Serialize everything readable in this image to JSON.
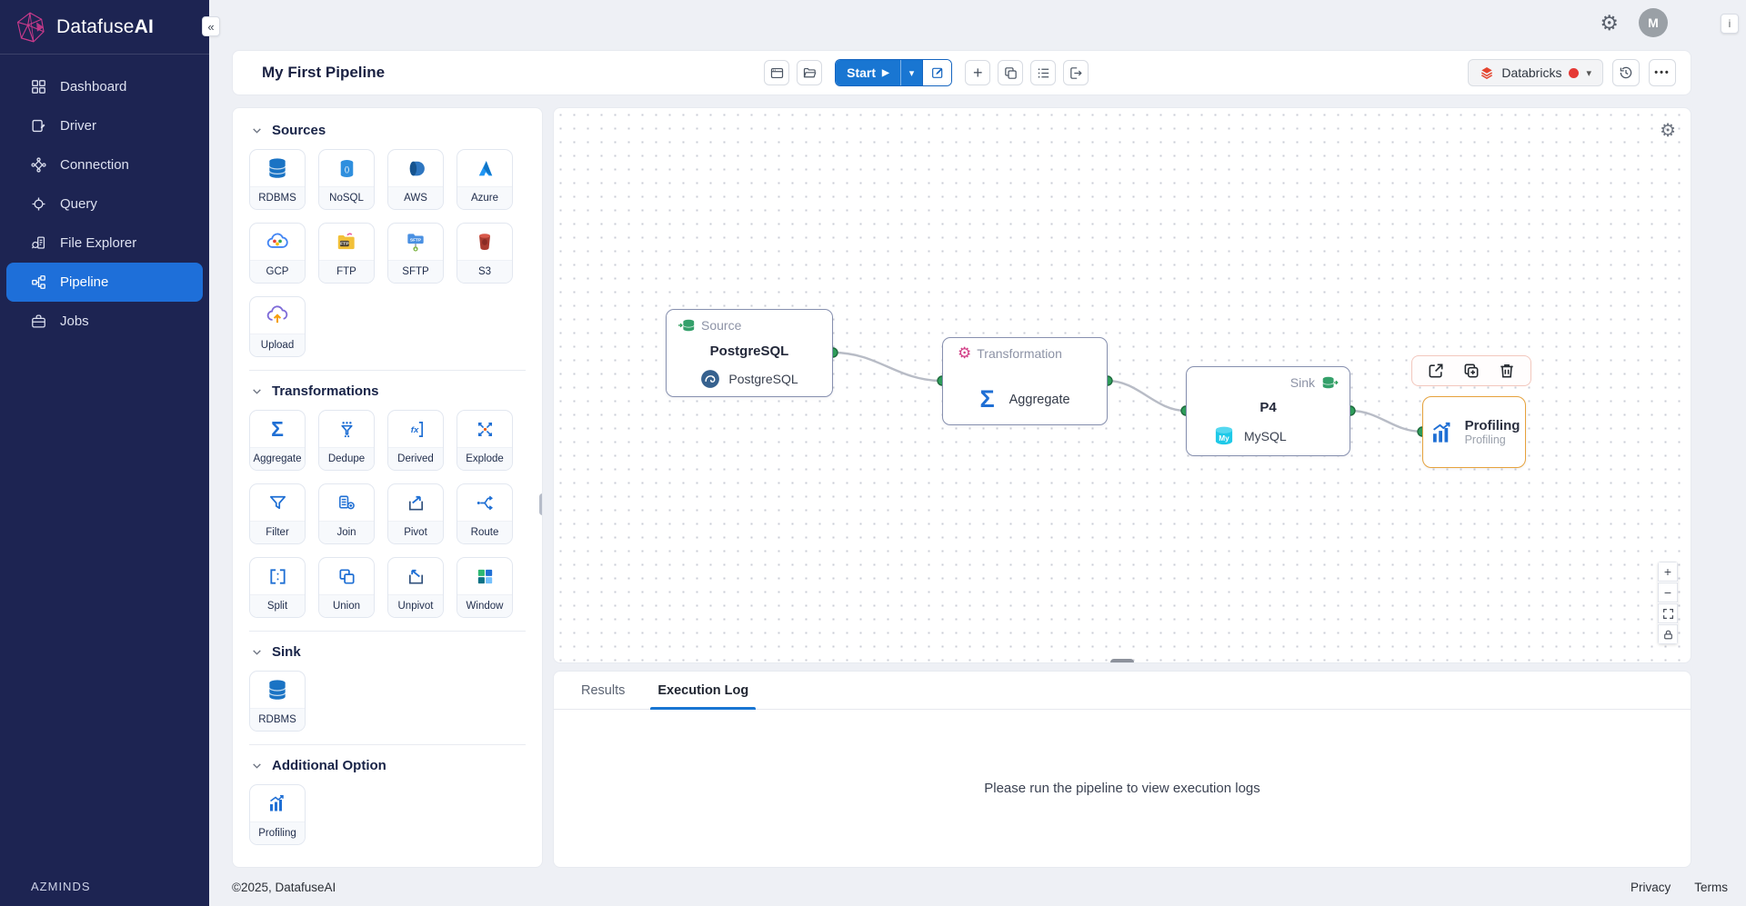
{
  "brand": {
    "name_regular": "Datafuse",
    "name_bold": "AI",
    "org": "AZMINDS"
  },
  "sidebar": {
    "active_item": "Pipeline",
    "items": [
      {
        "label": "Dashboard"
      },
      {
        "label": "Driver"
      },
      {
        "label": "Connection"
      },
      {
        "label": "Query"
      },
      {
        "label": "File Explorer"
      },
      {
        "label": "Pipeline"
      },
      {
        "label": "Jobs"
      }
    ]
  },
  "topbar": {
    "avatar_initial": "M",
    "info_badge": "i"
  },
  "header": {
    "title": "My First Pipeline",
    "start_label": "Start",
    "connection_label": "Databricks"
  },
  "palette": {
    "sections": [
      {
        "title": "Sources",
        "items": [
          "RDBMS",
          "NoSQL",
          "AWS",
          "Azure",
          "GCP",
          "FTP",
          "SFTP",
          "S3",
          "Upload"
        ]
      },
      {
        "title": "Transformations",
        "items": [
          "Aggregate",
          "Dedupe",
          "Derived",
          "Explode",
          "Filter",
          "Join",
          "Pivot",
          "Route",
          "Split",
          "Union",
          "Unpivot",
          "Window"
        ]
      },
      {
        "title": "Sink",
        "items": [
          "RDBMS"
        ]
      },
      {
        "title": "Additional Option",
        "items": [
          "Profiling"
        ]
      }
    ]
  },
  "canvas": {
    "nodes": [
      {
        "type_label": "Source",
        "title": "PostgreSQL",
        "subtitle": "PostgreSQL"
      },
      {
        "type_label": "Transformation",
        "title": "Aggregate"
      },
      {
        "type_label": "Sink",
        "title": "P4",
        "subtitle": "MySQL"
      },
      {
        "title": "Profiling",
        "subtitle": "Profiling"
      }
    ]
  },
  "results": {
    "tabs": [
      "Results",
      "Execution Log"
    ],
    "active_tab": "Execution Log",
    "empty_message": "Please run the pipeline to view execution logs"
  },
  "footer": {
    "copyright": "©2025, DatafuseAI",
    "links": [
      "Privacy",
      "Terms"
    ]
  },
  "icons": {
    "sigma": "Σ",
    "gear": "⚙",
    "collapse": "«",
    "play": "▶",
    "caret_down": "▾",
    "ellipsis": "•••",
    "plus": "+",
    "minus": "−",
    "fx": "fx",
    "brackets": "()",
    "ftp_label": "FTP",
    "sftp_label": "SFTP",
    "mysql_label": "My"
  },
  "colors": {
    "primary": "#1976d2",
    "sidebar_bg": "#1d2452",
    "active_nav": "#1e6fd9",
    "databricks_red": "#e4442e",
    "status_dot": "#e53935",
    "port_green": "#2f9e5b",
    "profiling_border": "#e6a23c",
    "edge_gray": "#b8bcc6"
  }
}
